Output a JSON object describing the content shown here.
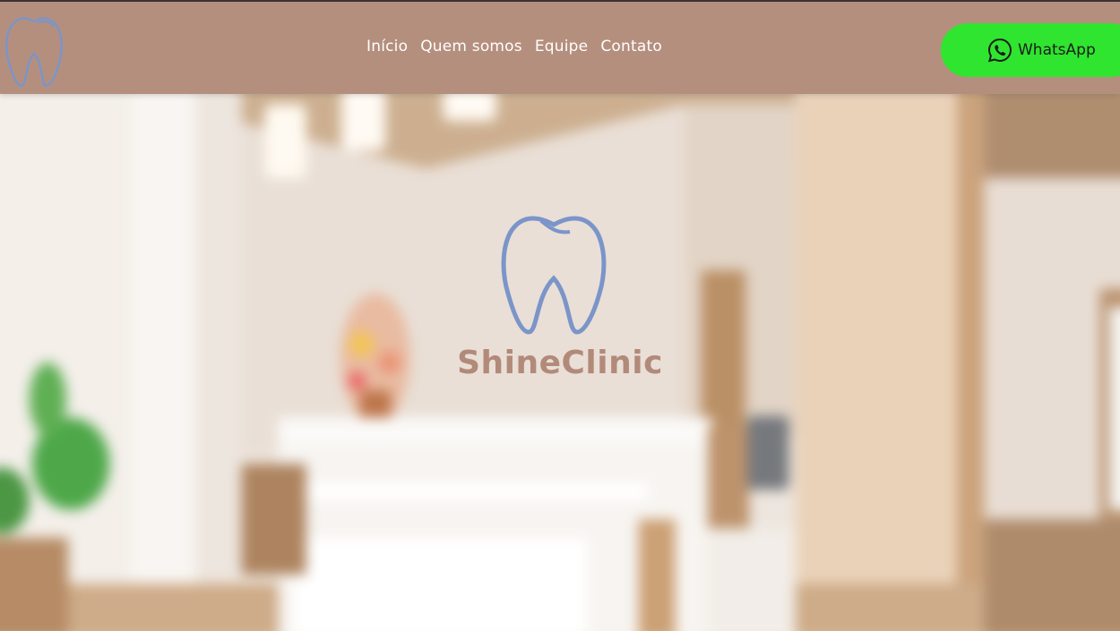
{
  "nav": {
    "logo_icon": "tooth-icon",
    "links": [
      "Início",
      "Quem somos",
      "Equipe",
      "Contato"
    ],
    "whatsapp": {
      "label": "WhatsApp",
      "icon": "whatsapp-icon",
      "color": "#2fe52f"
    }
  },
  "hero": {
    "logo_icon": "tooth-icon",
    "brand_name": "ShineClinic",
    "background": "blurred-clinic-reception-photo"
  },
  "colors": {
    "navbar": "#b58f7e",
    "tooth_blue": "#7b95c9",
    "brand_text": "#b28a7a"
  }
}
